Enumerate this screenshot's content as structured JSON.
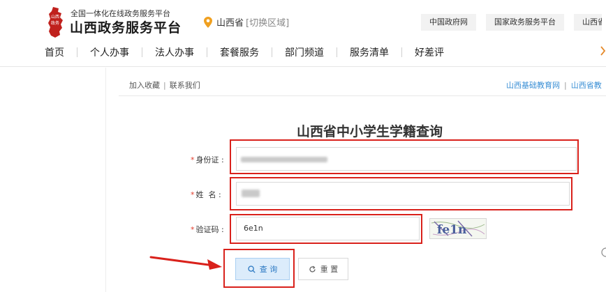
{
  "header": {
    "logo_subtitle": "全国一体化在线政务服务平台",
    "logo_title": "山西政务服务平台",
    "emblem_text": "山西政务",
    "location": {
      "name": "山西省",
      "switch_label": "[切换区域]",
      "icon": "location-pin-icon"
    },
    "top_links": [
      "中国政府网",
      "国家政务服务平台",
      "山西省"
    ]
  },
  "nav": {
    "items": [
      "首页",
      "个人办事",
      "法人办事",
      "套餐服务",
      "部门频道",
      "服务清单",
      "好差评"
    ],
    "more_icon": "chevron-right-icon"
  },
  "subbar": {
    "left_links": [
      "加入收藏",
      "联系我们"
    ],
    "right_links": [
      "山西基础教育网",
      "山西省教"
    ]
  },
  "form": {
    "title": "山西省中小学生学籍查询",
    "id_label": "身份证",
    "name_label": "姓  名",
    "captcha_label": "验证码",
    "required_mark": "*",
    "colon": ":",
    "id_value": "",
    "name_value": "",
    "captcha_value": "6e1n",
    "captcha_image_text": "fe1n",
    "query_button": "查 询",
    "reset_button": "重 置",
    "query_icon": "search-icon",
    "reset_icon": "refresh-icon"
  },
  "annotation": {
    "highlight_color": "#d9211b",
    "arrow_color": "#d9211b"
  }
}
